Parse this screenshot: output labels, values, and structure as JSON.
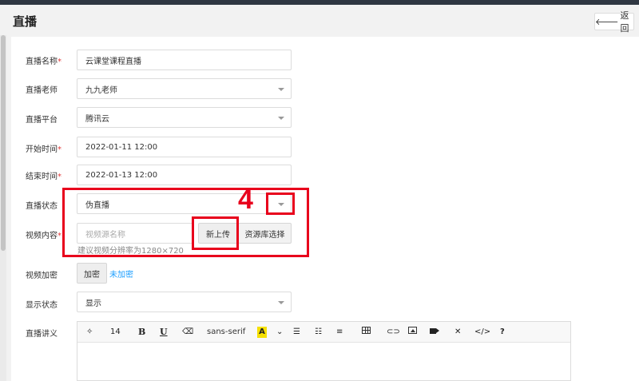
{
  "header": {
    "title": "直播",
    "back_label": "返回",
    "back_icon": "arrow-left-icon"
  },
  "form": {
    "name": {
      "label": "直播名称",
      "required": true,
      "value": "云课堂课程直播"
    },
    "teacher": {
      "label": "直播老师",
      "required": false,
      "value": "九九老师"
    },
    "platform": {
      "label": "直播平台",
      "required": false,
      "value": "腾讯云"
    },
    "start_time": {
      "label": "开始时间",
      "required": true,
      "value": "2022-01-11 12:00"
    },
    "end_time": {
      "label": "结束时间",
      "required": true,
      "value": "2022-01-13 12:00"
    },
    "status": {
      "label": "直播状态",
      "required": false,
      "value": "伪直播"
    },
    "video": {
      "label": "视频内容",
      "required": true,
      "placeholder": "视频源名称",
      "upload_label": "新上传",
      "library_label": "资源库选择",
      "hint": "建议视频分辨率为1280×720"
    },
    "encrypt": {
      "label": "视频加密",
      "button_label": "加密",
      "state_link": "未加密"
    },
    "display": {
      "label": "显示状态",
      "value": "显示"
    },
    "notes": {
      "label": "直播讲义",
      "toolbar": {
        "magic": "magic-wand-icon",
        "font_size": "14",
        "bold": "B",
        "underline": "U",
        "eraser": "eraser-icon",
        "font_family": "sans-serif",
        "color": "A",
        "color_dropdown": "chevron-down-icon",
        "ul": "unordered-list-icon",
        "ol": "ordered-list-icon",
        "align": "align-left-icon",
        "table": "table-icon",
        "link": "link-icon",
        "image": "image-icon",
        "video": "video-icon",
        "fullscreen": "fullscreen-icon",
        "code": "</>",
        "help": "?"
      }
    }
  },
  "annotation": {
    "number": "4",
    "color": "#e8001c"
  },
  "colors": {
    "accent": "#1e9fff",
    "required": "#e23b3b"
  }
}
